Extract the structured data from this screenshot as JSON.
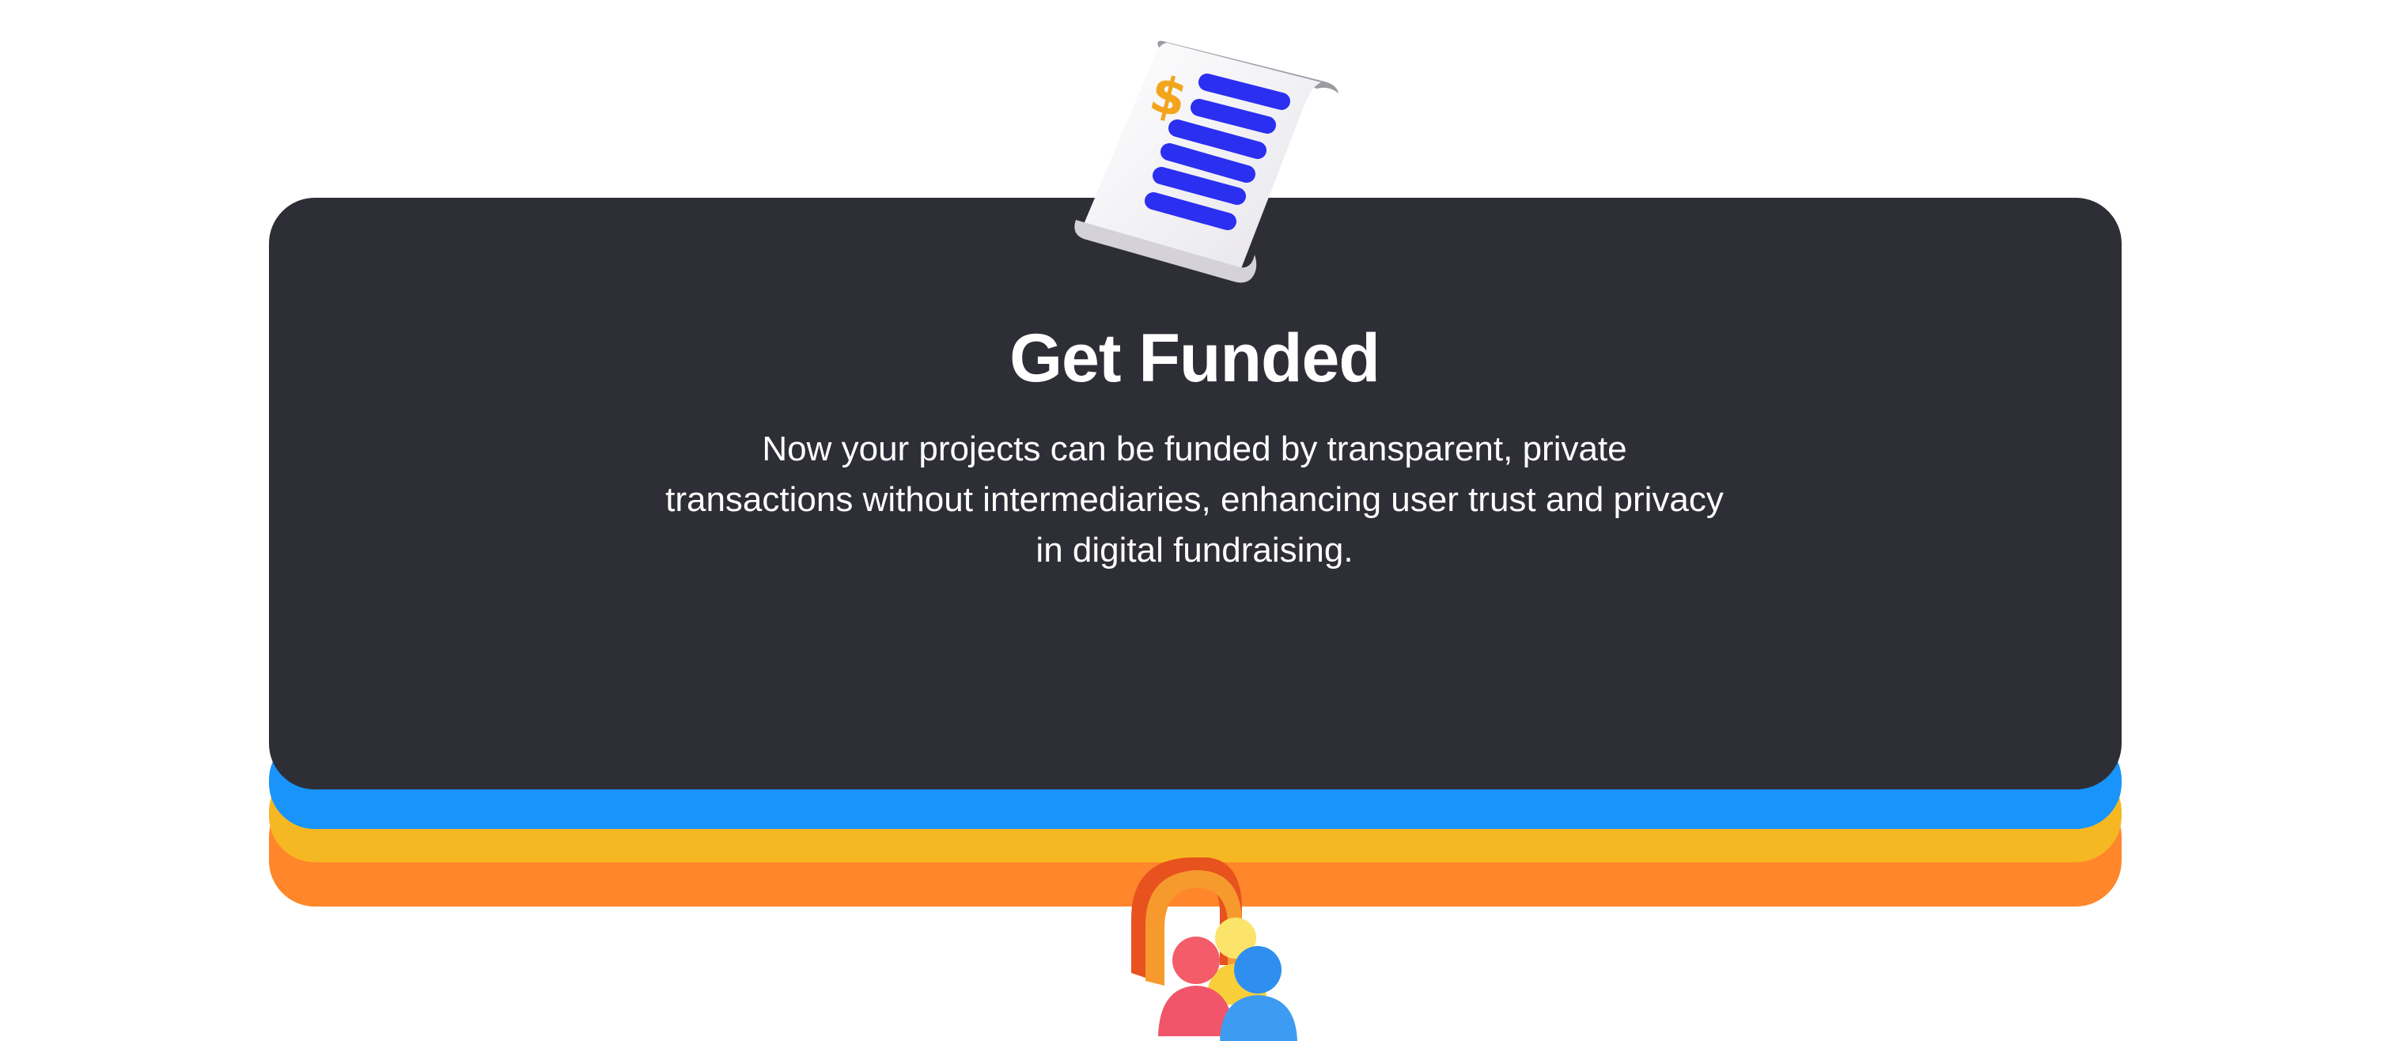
{
  "card": {
    "title": "Get Funded",
    "description": "Now your projects can be funded by transparent, private transactions without intermediaries, enhancing user trust and privacy in digital fundraising."
  },
  "icons": {
    "top": "receipt-dollar-icon",
    "bottom": "lock-community-icon"
  },
  "colors": {
    "card": "#2E2E37",
    "blue_layer": "#1894FA",
    "yellow_layer": "#F6B822",
    "orange_layer": "#FF862A",
    "receipt_lines": "#2B2FF0",
    "dollar": "#F2A51C"
  }
}
